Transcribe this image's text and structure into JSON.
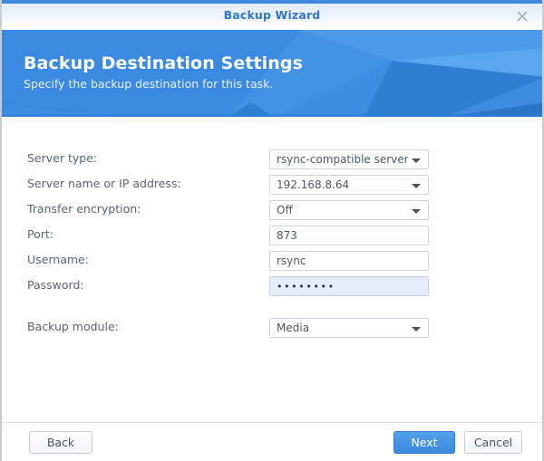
{
  "window": {
    "title": "Backup Wizard",
    "close_icon": "close-icon"
  },
  "banner": {
    "title": "Backup Destination Settings",
    "subtitle": "Specify the backup destination for this task.",
    "accent_color": "#3b8ae2"
  },
  "form": {
    "fields": [
      {
        "label": "Server type:",
        "value": "rsync-compatible server",
        "control": "dropdown",
        "name": "server-type"
      },
      {
        "label": "Server name or IP address:",
        "value": "192.168.8.64",
        "control": "dropdown",
        "name": "server-address"
      },
      {
        "label": "Transfer encryption:",
        "value": "Off",
        "control": "dropdown",
        "name": "transfer-encryption"
      },
      {
        "label": "Port:",
        "value": "873",
        "control": "text",
        "name": "port"
      },
      {
        "label": "Username:",
        "value": "rsync",
        "control": "text",
        "name": "username"
      },
      {
        "label": "Password:",
        "value": "••••••••",
        "control": "password",
        "name": "password",
        "focused": true
      },
      {
        "label": "Backup module:",
        "value": "Media",
        "control": "dropdown",
        "name": "backup-module"
      }
    ]
  },
  "footer": {
    "back_label": "Back",
    "next_label": "Next",
    "cancel_label": "Cancel",
    "primary_color": "#3b87dd"
  }
}
